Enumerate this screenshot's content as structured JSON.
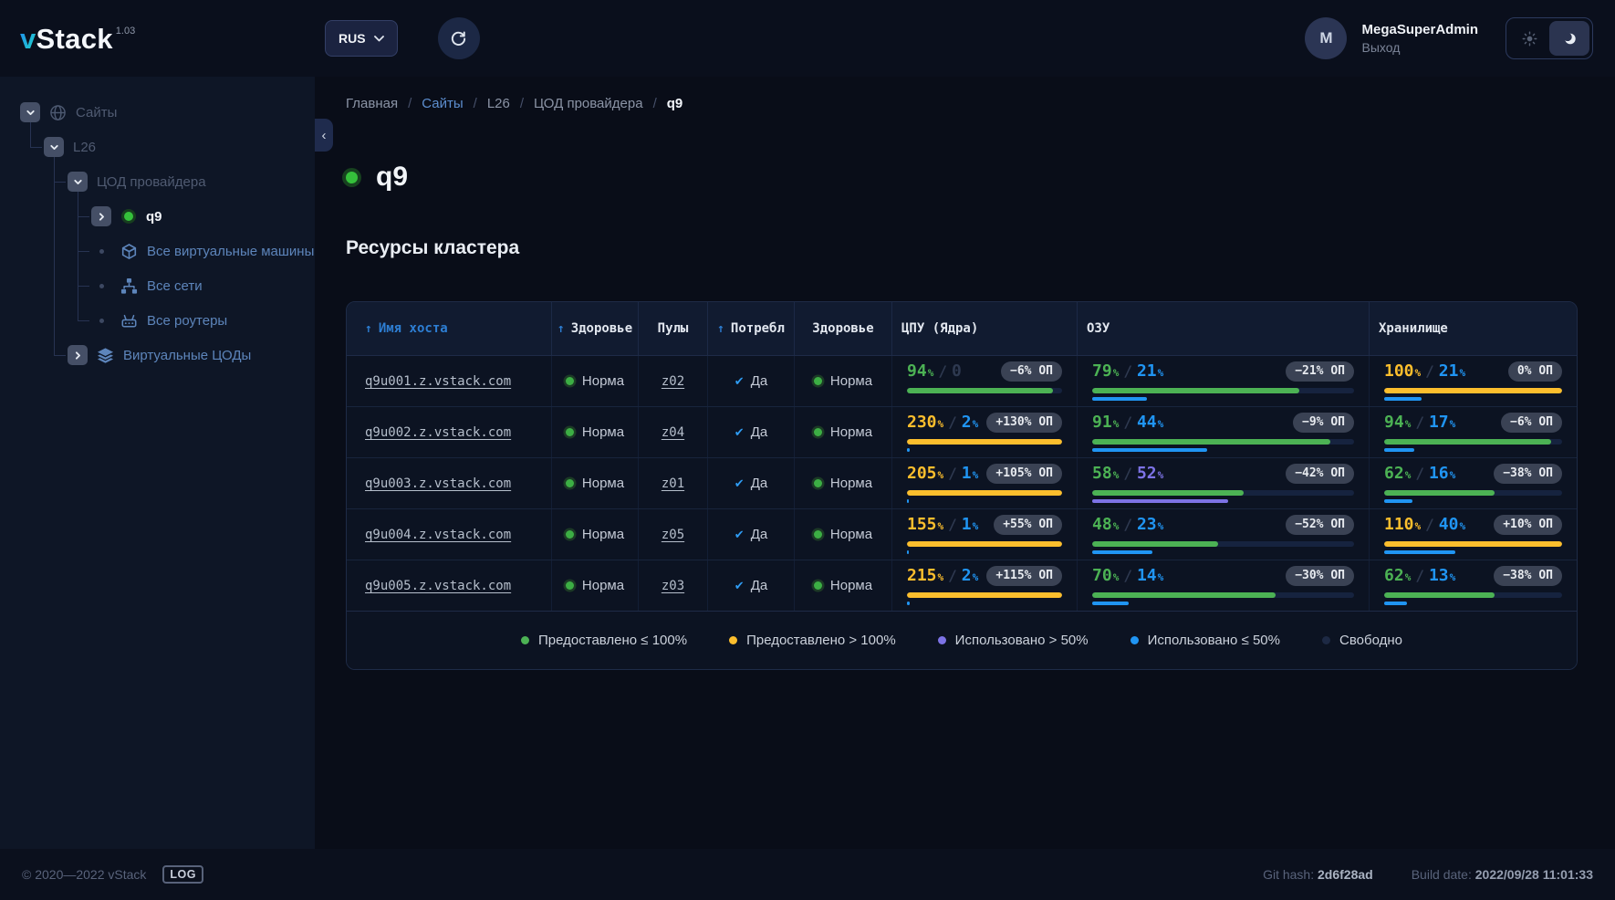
{
  "header": {
    "brand": {
      "mark": "v",
      "name": "Stack",
      "version": "1.03"
    },
    "language": {
      "label": "RUS"
    },
    "user": {
      "initial": "M",
      "name": "MegaSuperAdmin",
      "logout": "Выход"
    }
  },
  "sidebar": {
    "items": [
      {
        "name": "sites",
        "depth": 0,
        "toggle": "expanded",
        "icon": "globe",
        "label": "Сайты",
        "style": "dim"
      },
      {
        "name": "l26",
        "depth": 1,
        "toggle": "expanded",
        "icon": null,
        "label": "L26",
        "style": "dim"
      },
      {
        "name": "provider-dc",
        "depth": 2,
        "toggle": "expanded",
        "icon": null,
        "label": "ЦОД провайдера",
        "style": "dim"
      },
      {
        "name": "q9",
        "depth": 3,
        "toggle": "collapsed",
        "icon": "status",
        "label": "q9",
        "style": "active"
      },
      {
        "name": "all-vms",
        "depth": 3,
        "toggle": null,
        "bullet": true,
        "icon": "cube",
        "label": "Все виртуальные машины",
        "style": "link"
      },
      {
        "name": "all-networks",
        "depth": 3,
        "toggle": null,
        "bullet": true,
        "icon": "network",
        "label": "Все сети",
        "style": "link"
      },
      {
        "name": "all-routers",
        "depth": 3,
        "toggle": null,
        "bullet": true,
        "icon": "router",
        "label": "Все роутеры",
        "style": "link"
      },
      {
        "name": "virtual-dcs",
        "depth": 2,
        "toggle": "collapsed",
        "icon": "layers",
        "label": "Виртуальные ЦОДы",
        "style": "link"
      }
    ]
  },
  "breadcrumb": {
    "items": [
      {
        "name": "home",
        "label": "Главная",
        "state": "link"
      },
      {
        "name": "sites",
        "label": "Сайты",
        "state": "accent"
      },
      {
        "name": "l26",
        "label": "L26",
        "state": "link"
      },
      {
        "name": "provider-dc",
        "label": "ЦОД провайдера",
        "state": "link"
      },
      {
        "name": "q9",
        "label": "q9",
        "state": "current"
      }
    ]
  },
  "page": {
    "title": "q9",
    "section_title": "Ресурсы кластера"
  },
  "table": {
    "columns": [
      {
        "name": "host",
        "label": "Имя хоста",
        "sorted": true,
        "accent": true,
        "align": "left"
      },
      {
        "name": "health",
        "label": "Здоровье",
        "sorted": true,
        "align": "center"
      },
      {
        "name": "pools",
        "label": "Пулы",
        "align": "center"
      },
      {
        "name": "consumes",
        "label": "Потребл",
        "sorted": true,
        "align": "center"
      },
      {
        "name": "vdc-health",
        "label": "Здоровье",
        "align": "center"
      },
      {
        "name": "cpu",
        "label": "ЦПУ (Ядра)",
        "align": "left"
      },
      {
        "name": "ram",
        "label": "ОЗУ",
        "align": "left"
      },
      {
        "name": "storage",
        "label": "Хранилище",
        "align": "left"
      }
    ],
    "rows": [
      {
        "host": "q9u001.z.vstack.com",
        "health": "Норма",
        "pool": "z02",
        "consumes": "Да",
        "vdc_health": "Норма",
        "cpu": {
          "provided": 94,
          "used": 0,
          "used_display": "0",
          "badge": "−6% ОП",
          "provided_state": "ok",
          "used_state": "zero"
        },
        "ram": {
          "provided": 79,
          "used": 21,
          "badge": "−21% ОП",
          "provided_state": "ok",
          "used_state": "low"
        },
        "storage": {
          "provided": 100,
          "used": 21,
          "badge": "0% ОП",
          "provided_state": "over",
          "used_state": "low"
        }
      },
      {
        "host": "q9u002.z.vstack.com",
        "health": "Норма",
        "pool": "z04",
        "consumes": "Да",
        "vdc_health": "Норма",
        "cpu": {
          "provided": 230,
          "used": 2,
          "badge": "+130% ОП",
          "provided_state": "over",
          "used_state": "low"
        },
        "ram": {
          "provided": 91,
          "used": 44,
          "badge": "−9% ОП",
          "provided_state": "ok",
          "used_state": "low"
        },
        "storage": {
          "provided": 94,
          "used": 17,
          "badge": "−6% ОП",
          "provided_state": "ok",
          "used_state": "low"
        }
      },
      {
        "host": "q9u003.z.vstack.com",
        "health": "Норма",
        "pool": "z01",
        "consumes": "Да",
        "vdc_health": "Норма",
        "cpu": {
          "provided": 205,
          "used": 1,
          "badge": "+105% ОП",
          "provided_state": "over",
          "used_state": "low"
        },
        "ram": {
          "provided": 58,
          "used": 52,
          "badge": "−42% ОП",
          "provided_state": "ok",
          "used_state": "high"
        },
        "storage": {
          "provided": 62,
          "used": 16,
          "badge": "−38% ОП",
          "provided_state": "ok",
          "used_state": "low"
        }
      },
      {
        "host": "q9u004.z.vstack.com",
        "health": "Норма",
        "pool": "z05",
        "consumes": "Да",
        "vdc_health": "Норма",
        "cpu": {
          "provided": 155,
          "used": 1,
          "badge": "+55% ОП",
          "provided_state": "over",
          "used_state": "low"
        },
        "ram": {
          "provided": 48,
          "used": 23,
          "badge": "−52% ОП",
          "provided_state": "ok",
          "used_state": "low"
        },
        "storage": {
          "provided": 110,
          "used": 40,
          "badge": "+10% ОП",
          "provided_state": "over",
          "used_state": "low"
        }
      },
      {
        "host": "q9u005.z.vstack.com",
        "health": "Норма",
        "pool": "z03",
        "consumes": "Да",
        "vdc_health": "Норма",
        "cpu": {
          "provided": 215,
          "used": 2,
          "badge": "+115% ОП",
          "provided_state": "over",
          "used_state": "low"
        },
        "ram": {
          "provided": 70,
          "used": 14,
          "badge": "−30% ОП",
          "provided_state": "ok",
          "used_state": "low"
        },
        "storage": {
          "provided": 62,
          "used": 13,
          "badge": "−38% ОП",
          "provided_state": "ok",
          "used_state": "low"
        }
      }
    ],
    "legend": [
      {
        "color": "#4cb254",
        "label": "Предоставлено ≤ 100%"
      },
      {
        "color": "#fcbe2d",
        "label": "Предоставлено > 100%"
      },
      {
        "color": "#7d73e6",
        "label": "Использовано > 50%"
      },
      {
        "color": "#2095f3",
        "label": "Использовано ≤ 50%"
      },
      {
        "color": "#1d2944",
        "label": "Свободно"
      }
    ]
  },
  "footer": {
    "copyright": "© 2020—2022 vStack",
    "log_badge": "LOG",
    "git_hash_label": "Git hash:",
    "git_hash": "2d6f28ad",
    "build_date_label": "Build date:",
    "build_date": "2022/09/28 11:01:33"
  },
  "colors": {
    "green": "#4cb254",
    "yellow": "#fcbe2d",
    "blue": "#2095f3",
    "purple": "#7d73e6",
    "free": "#16233f",
    "status_ok": "#35c03b"
  }
}
